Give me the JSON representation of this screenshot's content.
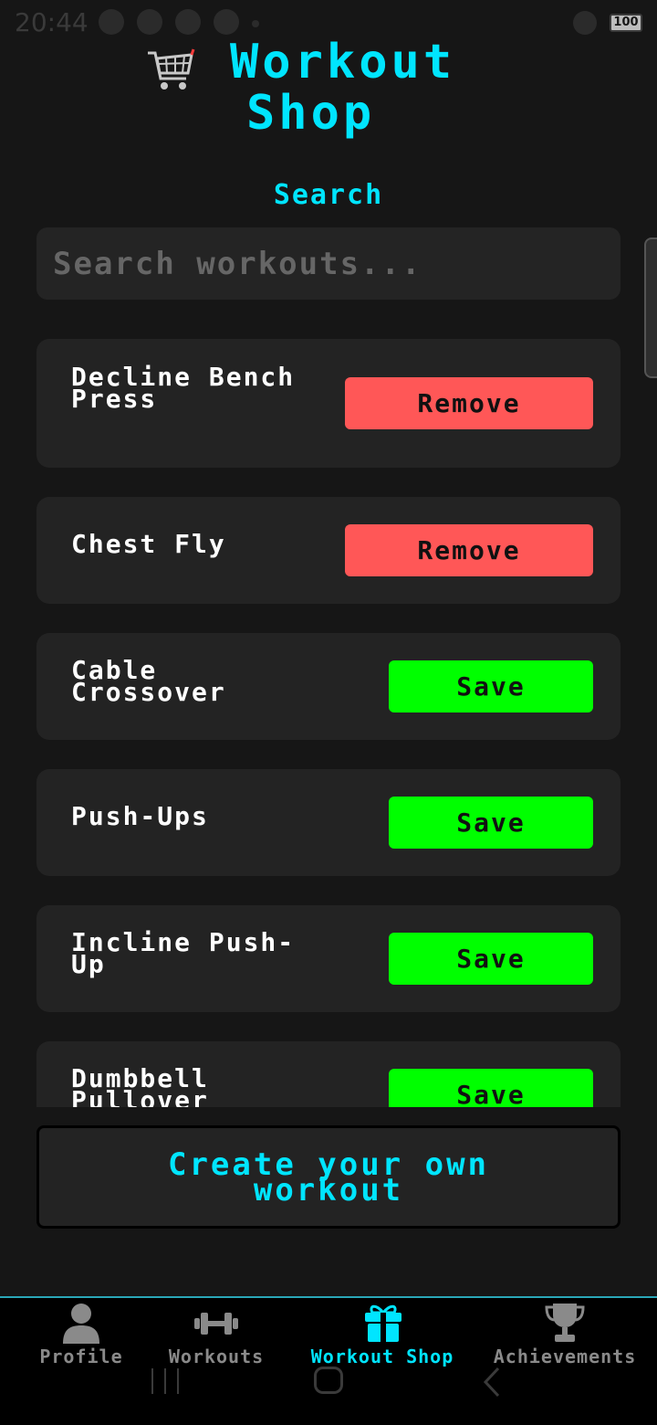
{
  "status_bar": {
    "time": "20:44",
    "battery": "100"
  },
  "header": {
    "title_line1": "Workout",
    "title_line2": "Shop",
    "icon": "shopping-cart-icon"
  },
  "search": {
    "label": "Search",
    "placeholder": "Search workouts..."
  },
  "workouts": [
    {
      "name": "Decline Bench Press",
      "action": "Remove"
    },
    {
      "name": "Chest Fly",
      "action": "Remove"
    },
    {
      "name": "Cable Crossover",
      "action": "Save"
    },
    {
      "name": "Push-Ups",
      "action": "Save"
    },
    {
      "name": "Incline Push-Up",
      "action": "Save"
    },
    {
      "name": "Dumbbell Pullover",
      "action": "Save"
    }
  ],
  "create_button": {
    "label": "Create your own workout"
  },
  "bottom_nav": {
    "items": [
      {
        "label": "Profile",
        "icon": "person-icon"
      },
      {
        "label": "Workouts",
        "icon": "dumbbell-icon"
      },
      {
        "label": "Workout Shop",
        "icon": "gift-icon",
        "active": true
      },
      {
        "label": "Achievements",
        "icon": "trophy-icon"
      }
    ]
  },
  "colors": {
    "accent": "#00e5ff",
    "remove": "#ff5757",
    "save": "#00ff00",
    "background": "#161616",
    "card": "#232323"
  }
}
